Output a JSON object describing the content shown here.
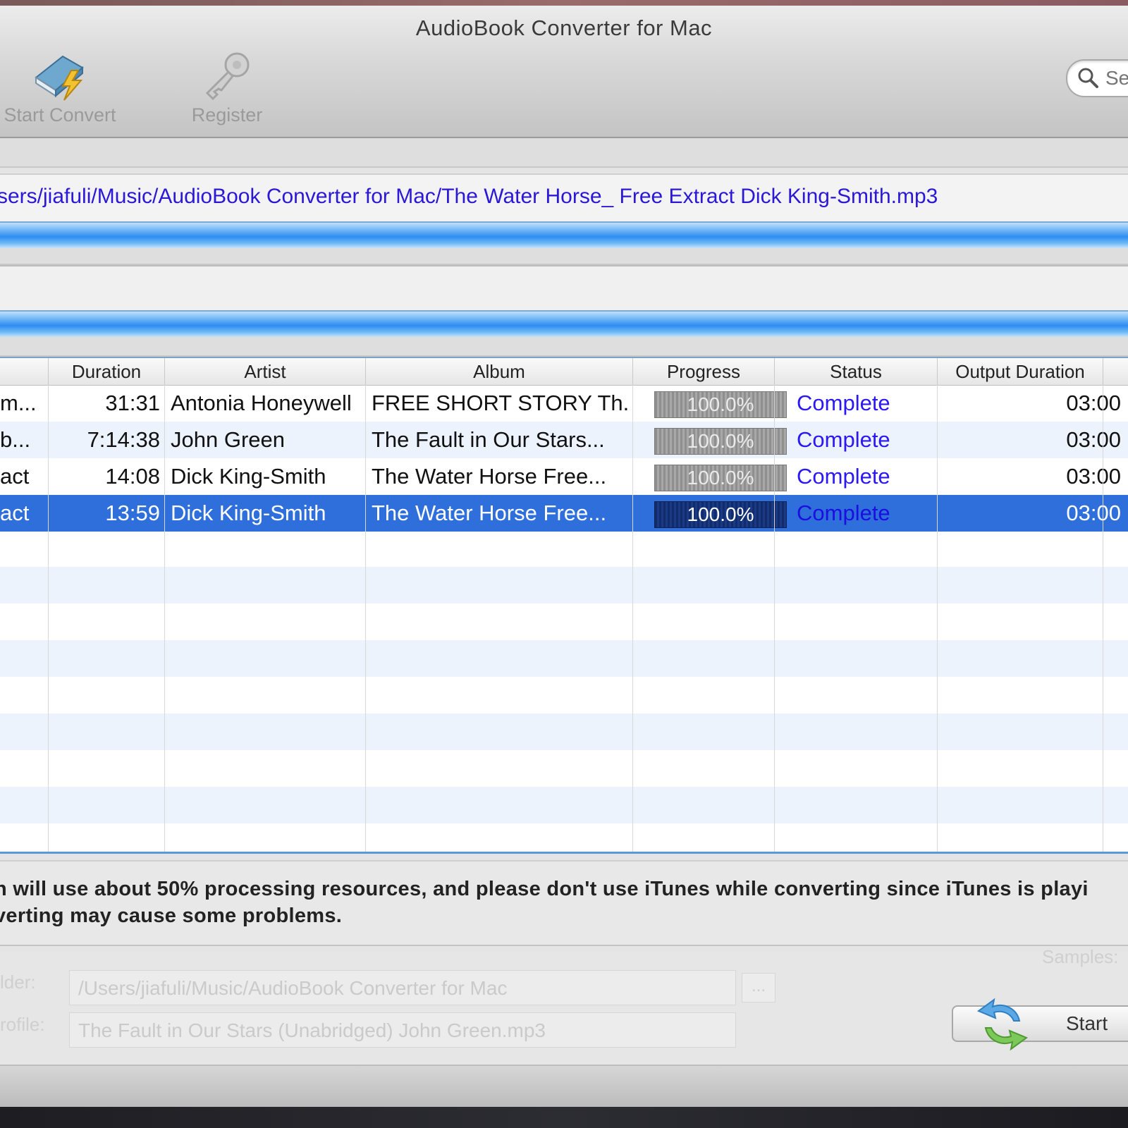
{
  "window": {
    "title": "AudioBook Converter for Mac"
  },
  "toolbar": {
    "start_convert_label": "Start Convert",
    "register_label": "Register",
    "search_placeholder": "Se"
  },
  "path": "sers/jiafuli/Music/AudioBook Converter for Mac/The Water Horse_ Free Extract Dick King-Smith.mp3",
  "table": {
    "headers": [
      "Duration",
      "Artist",
      "Album",
      "Progress",
      "Status",
      "Output Duration"
    ],
    "rows": [
      {
        "name": "m...",
        "duration": "31:31",
        "artist": "Antonia Honeywell",
        "album": "FREE SHORT STORY Th...",
        "progress_label": "100.0%",
        "progress": 1.0,
        "status": "Complete",
        "output_duration": "03:00"
      },
      {
        "name": "b...",
        "duration": "7:14:38",
        "artist": "John Green",
        "album": "The Fault in Our Stars...",
        "progress_label": "100.0%",
        "progress": 1.0,
        "status": "Complete",
        "output_duration": "03:00"
      },
      {
        "name": "act",
        "duration": "14:08",
        "artist": "Dick King-Smith",
        "album": "The Water Horse Free...",
        "progress_label": "100.0%",
        "progress": 1.0,
        "status": "Complete",
        "output_duration": "03:00"
      },
      {
        "name": "act",
        "duration": "13:59",
        "artist": "Dick King-Smith",
        "album": "The Water Horse Free...",
        "progress_label": "100.0%",
        "progress": 1.0,
        "status": "Complete",
        "output_duration": "03:00",
        "selected": true
      }
    ]
  },
  "notice": {
    "line1": "n will use about 50% processing resources, and please don't use iTunes while converting since iTunes is playi",
    "line2": "verting may cause some problems."
  },
  "bottom": {
    "folder_label": "lder:",
    "folder_value": "/Users/jiafuli/Music/AudioBook Converter for Mac",
    "file_label": "rofile:",
    "file_value": "The Fault in Our Stars (Unabridged) John Green.mp3",
    "browse_label": "...",
    "samples_label": "Samples:",
    "start_label": "Start"
  },
  "colors": {
    "status_text": "#2b18f2",
    "path_text": "#2b18d6",
    "selection": "#2f6fdb",
    "row_alt": "#edf3fd"
  }
}
